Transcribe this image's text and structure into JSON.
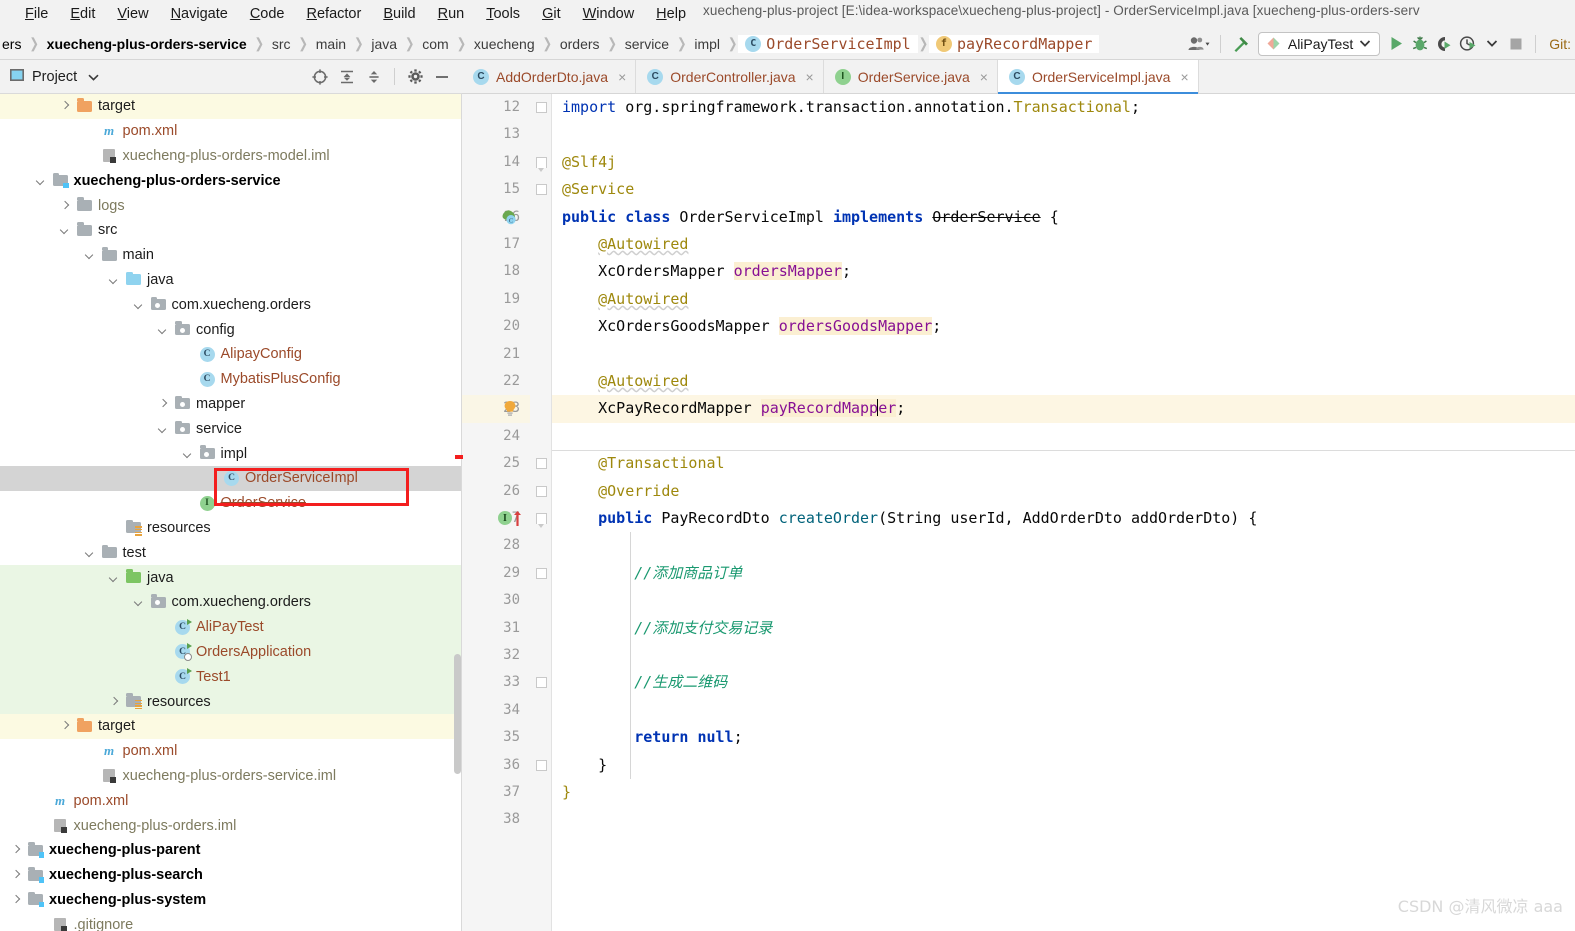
{
  "window": {
    "title": "xuecheng-plus-project [E:\\idea-workspace\\xuecheng-plus-project] - OrderServiceImpl.java [xuecheng-plus-orders-serv"
  },
  "menu": {
    "items": [
      {
        "label": "File"
      },
      {
        "label": "Edit"
      },
      {
        "label": "View"
      },
      {
        "label": "Navigate"
      },
      {
        "label": "Code"
      },
      {
        "label": "Refactor"
      },
      {
        "label": "Build"
      },
      {
        "label": "Run"
      },
      {
        "label": "Tools"
      },
      {
        "label": "Git"
      },
      {
        "label": "Window"
      },
      {
        "label": "Help"
      }
    ]
  },
  "navbar": {
    "breadcrumbs": [
      {
        "label": "ers",
        "icon": "none"
      },
      {
        "label": "xuecheng-plus-orders-service",
        "icon": "none"
      },
      {
        "label": "src",
        "icon": "none"
      },
      {
        "label": "main",
        "icon": "none"
      },
      {
        "label": "java",
        "icon": "none"
      },
      {
        "label": "com",
        "icon": "none"
      },
      {
        "label": "xuecheng",
        "icon": "none"
      },
      {
        "label": "orders",
        "icon": "none"
      },
      {
        "label": "service",
        "icon": "none"
      },
      {
        "label": "impl",
        "icon": "none"
      },
      {
        "label": "OrderServiceImpl",
        "icon": "class-icon"
      },
      {
        "label": "payRecordMapper",
        "icon": "field-icon"
      }
    ],
    "toolbar": {
      "users_icon": "users-icon",
      "users_dropdown_icon": "chevron-down-icon",
      "build_icon": "hammer-icon",
      "run_config": "AliPayTest",
      "run_config_icon": "run-config-icon",
      "run_config_dropdown": "chevron-down-icon",
      "run_icon": "run-icon",
      "debug_icon": "debug-icon",
      "run_coverage_icon": "run-with-coverage-icon",
      "profiler_icon": "profiler-icon",
      "profiler_dropdown": "chevron-down-icon",
      "stop_icon": "stop-icon",
      "git_label": "Git:"
    }
  },
  "project_panel": {
    "title": "Project",
    "title_icon": "project-icon",
    "title_dropdown": "chevron-down-icon",
    "icons": [
      {
        "name": "locate-icon"
      },
      {
        "name": "expand-all-icon"
      },
      {
        "name": "collapse-all-icon"
      },
      {
        "name": "settings-gear-icon"
      },
      {
        "name": "hide-minimize-icon"
      }
    ],
    "tree": [
      {
        "label": "target",
        "indent": 3,
        "arrow": "right",
        "icon": "folder-orange",
        "style": "yellow"
      },
      {
        "label": "pom.xml",
        "indent": 4,
        "arrow": "none",
        "icon": "maven-m",
        "style": "orange"
      },
      {
        "label": "xuecheng-plus-orders-model.iml",
        "indent": 4,
        "arrow": "none",
        "icon": "iml",
        "style": "dim"
      },
      {
        "label": "xuecheng-plus-orders-service",
        "indent": 2,
        "arrow": "down",
        "icon": "module-gray",
        "style": "bold"
      },
      {
        "label": "logs",
        "indent": 3,
        "arrow": "right",
        "icon": "folder-gray",
        "style": "dim"
      },
      {
        "label": "src",
        "indent": 3,
        "arrow": "down",
        "icon": "folder-gray",
        "style": "normal"
      },
      {
        "label": "main",
        "indent": 4,
        "arrow": "down",
        "icon": "folder-gray",
        "style": "normal"
      },
      {
        "label": "java",
        "indent": 5,
        "arrow": "down",
        "icon": "folder-blue",
        "style": "normal"
      },
      {
        "label": "com.xuecheng.orders",
        "indent": 6,
        "arrow": "down",
        "icon": "package",
        "style": "normal"
      },
      {
        "label": "config",
        "indent": 7,
        "arrow": "down",
        "icon": "package",
        "style": "normal"
      },
      {
        "label": "AlipayConfig",
        "indent": 8,
        "arrow": "none",
        "icon": "class",
        "style": "orange"
      },
      {
        "label": "MybatisPlusConfig",
        "indent": 8,
        "arrow": "none",
        "icon": "class",
        "style": "orange"
      },
      {
        "label": "mapper",
        "indent": 7,
        "arrow": "right",
        "icon": "package",
        "style": "normal"
      },
      {
        "label": "service",
        "indent": 7,
        "arrow": "down",
        "icon": "package",
        "style": "normal"
      },
      {
        "label": "impl",
        "indent": 8,
        "arrow": "down",
        "icon": "package",
        "style": "normal"
      },
      {
        "label": "OrderServiceImpl",
        "indent": 9,
        "arrow": "none",
        "icon": "class",
        "style": "orange-selected"
      },
      {
        "label": "OrderService",
        "indent": 8,
        "arrow": "none",
        "icon": "interface",
        "style": "orange-strike"
      },
      {
        "label": "resources",
        "indent": 5,
        "arrow": "none",
        "icon": "resources",
        "style": "normal"
      },
      {
        "label": "test",
        "indent": 4,
        "arrow": "down",
        "icon": "folder-gray",
        "style": "normal"
      },
      {
        "label": "java",
        "indent": 5,
        "arrow": "down",
        "icon": "folder-green",
        "style": "green"
      },
      {
        "label": "com.xuecheng.orders",
        "indent": 6,
        "arrow": "down",
        "icon": "package",
        "style": "green"
      },
      {
        "label": "AliPayTest",
        "indent": 7,
        "arrow": "none",
        "icon": "class-run",
        "style": "green-orange"
      },
      {
        "label": "OrdersApplication",
        "indent": 7,
        "arrow": "none",
        "icon": "class-run-cfg",
        "style": "green-orange"
      },
      {
        "label": "Test1",
        "indent": 7,
        "arrow": "none",
        "icon": "class-run",
        "style": "green-orange"
      },
      {
        "label": "resources",
        "indent": 5,
        "arrow": "right",
        "icon": "resources-test",
        "style": "green"
      },
      {
        "label": "target",
        "indent": 3,
        "arrow": "right",
        "icon": "folder-orange",
        "style": "yellow"
      },
      {
        "label": "pom.xml",
        "indent": 4,
        "arrow": "none",
        "icon": "maven-m",
        "style": "orange"
      },
      {
        "label": "xuecheng-plus-orders-service.iml",
        "indent": 4,
        "arrow": "none",
        "icon": "iml",
        "style": "dim"
      },
      {
        "label": "pom.xml",
        "indent": 2,
        "arrow": "none",
        "icon": "maven-m",
        "style": "orange"
      },
      {
        "label": "xuecheng-plus-orders.iml",
        "indent": 2,
        "arrow": "none",
        "icon": "iml",
        "style": "dim"
      },
      {
        "label": "xuecheng-plus-parent",
        "indent": 1,
        "arrow": "right",
        "icon": "module-gray",
        "style": "bold"
      },
      {
        "label": "xuecheng-plus-search",
        "indent": 1,
        "arrow": "right",
        "icon": "module-gray",
        "style": "bold"
      },
      {
        "label": "xuecheng-plus-system",
        "indent": 1,
        "arrow": "right",
        "icon": "module-gray",
        "style": "bold"
      },
      {
        "label": ".gitignore",
        "indent": 2,
        "arrow": "none",
        "icon": "iml",
        "style": "dim"
      }
    ],
    "annotation": {
      "color": "#f31e1e",
      "target": "OrderServiceImpl"
    }
  },
  "editor": {
    "tabs": [
      {
        "label": "AddOrderDto.java",
        "icon": "class-icon",
        "active": false,
        "close": "×"
      },
      {
        "label": "OrderController.java",
        "icon": "class-icon",
        "active": false,
        "close": "×"
      },
      {
        "label": "OrderService.java",
        "icon": "interface-icon",
        "active": false,
        "close": "×"
      },
      {
        "label": "OrderServiceImpl.java",
        "icon": "class-icon",
        "active": true,
        "close": "×"
      }
    ],
    "first_line_number": 12,
    "last_line_number": 38,
    "lines": [
      {
        "n": 12,
        "text": "import org.springframework.transaction.annotation.Transactional;"
      },
      {
        "n": 13,
        "text": ""
      },
      {
        "n": 14,
        "text": "@Slf4j"
      },
      {
        "n": 15,
        "text": "@Service"
      },
      {
        "n": 16,
        "text": "public class OrderServiceImpl implements OrderService {"
      },
      {
        "n": 17,
        "text": "    @Autowired"
      },
      {
        "n": 18,
        "text": "    XcOrdersMapper ordersMapper;"
      },
      {
        "n": 19,
        "text": "    @Autowired"
      },
      {
        "n": 20,
        "text": "    XcOrdersGoodsMapper ordersGoodsMapper;"
      },
      {
        "n": 21,
        "text": ""
      },
      {
        "n": 22,
        "text": "    @Autowired"
      },
      {
        "n": 23,
        "text": "    XcPayRecordMapper payRecordMapper;"
      },
      {
        "n": 24,
        "text": ""
      },
      {
        "n": 25,
        "text": "    @Transactional"
      },
      {
        "n": 26,
        "text": "    @Override"
      },
      {
        "n": 27,
        "text": "    public PayRecordDto createOrder(String userId, AddOrderDto addOrderDto) {"
      },
      {
        "n": 28,
        "text": ""
      },
      {
        "n": 29,
        "text": "        //添加商品订单"
      },
      {
        "n": 30,
        "text": ""
      },
      {
        "n": 31,
        "text": "        //添加支付交易记录"
      },
      {
        "n": 32,
        "text": ""
      },
      {
        "n": 33,
        "text": "        //生成二维码"
      },
      {
        "n": 34,
        "text": ""
      },
      {
        "n": 35,
        "text": "        return null;"
      },
      {
        "n": 36,
        "text": "    }"
      },
      {
        "n": 37,
        "text": "}"
      },
      {
        "n": 38,
        "text": ""
      }
    ],
    "gutter_icons": [
      {
        "line": 16,
        "name": "spring-bean-icon"
      },
      {
        "line": 23,
        "name": "intention-bulb-icon"
      },
      {
        "line": 27,
        "name": "implementing-method-icon"
      }
    ],
    "caret": {
      "line": 23,
      "after": "payRecordMapp"
    },
    "highlighted_lines": [
      23
    ],
    "highlighted_identifiers": [
      "ordersMapper",
      "ordersGoodsMapper",
      "payRecordMapper"
    ]
  },
  "watermark": {
    "text": "CSDN @清风微凉 aaa"
  }
}
